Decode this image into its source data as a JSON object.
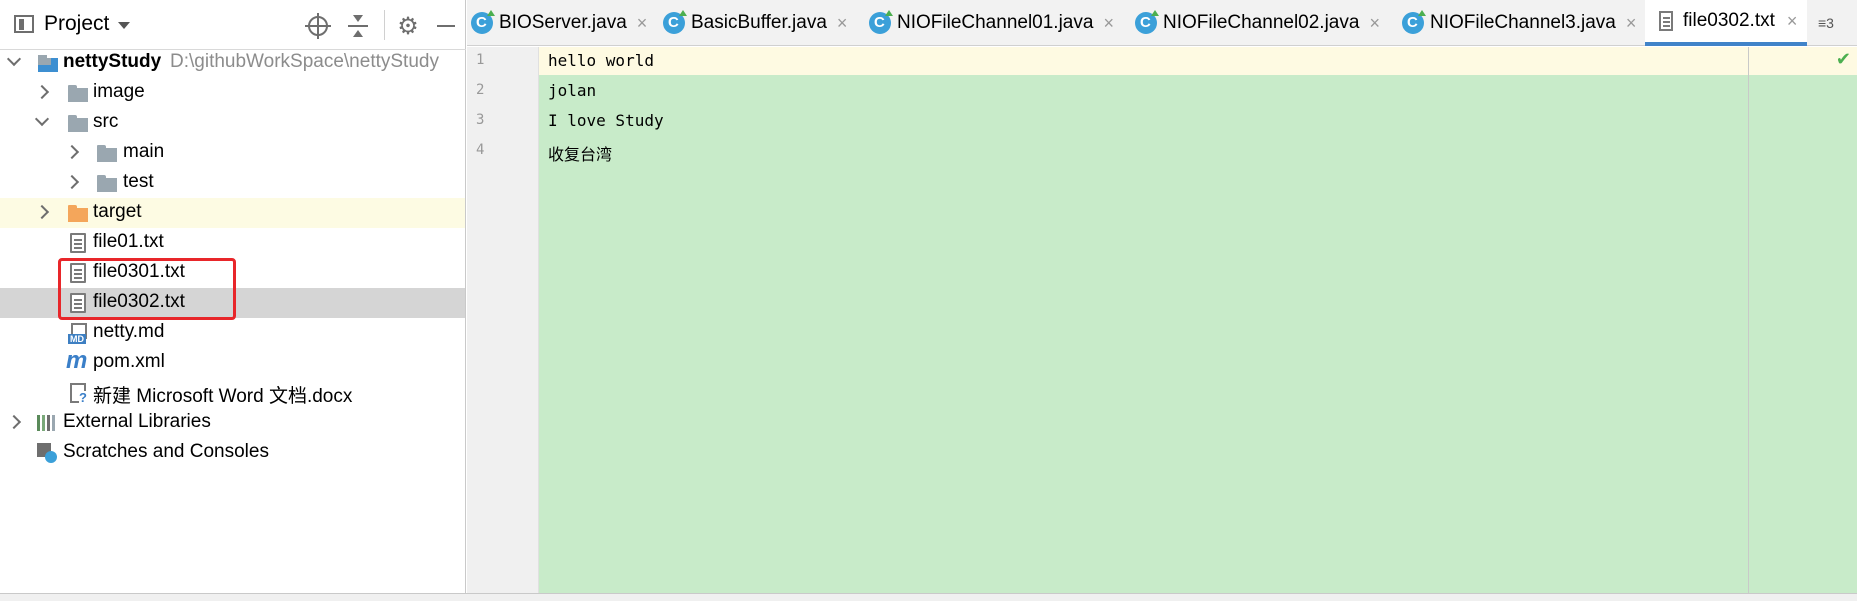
{
  "project_panel": {
    "title": "Project",
    "tree": {
      "root_name": "nettyStudy",
      "root_path": "D:\\githubWorkSpace\\nettyStudy",
      "items": [
        {
          "label": "image"
        },
        {
          "label": "src"
        },
        {
          "label": "main"
        },
        {
          "label": "test"
        },
        {
          "label": "target"
        },
        {
          "label": "file01.txt"
        },
        {
          "label": "file0301.txt"
        },
        {
          "label": "file0302.txt"
        },
        {
          "label": "netty.md"
        },
        {
          "label": "pom.xml"
        },
        {
          "label": "新建 Microsoft Word 文档.docx"
        },
        {
          "label": "External Libraries"
        },
        {
          "label": "Scratches and Consoles"
        }
      ]
    }
  },
  "tabs": [
    {
      "label": "BIOServer.java",
      "close": "×"
    },
    {
      "label": "BasicBuffer.java",
      "close": "×"
    },
    {
      "label": "NIOFileChannel01.java",
      "close": "×"
    },
    {
      "label": "NIOFileChannel02.java",
      "close": "×"
    },
    {
      "label": "NIOFileChannel3.java",
      "close": "×"
    },
    {
      "label": "file0302.txt",
      "close": "×"
    }
  ],
  "tab_overflow": "≡3",
  "editor": {
    "line_numbers": [
      "1",
      "2",
      "3",
      "4"
    ],
    "lines": [
      "hello world",
      "jolan",
      "I love Study",
      "收复台湾"
    ],
    "inspection_status": "✔"
  },
  "colors": {
    "editor_background": "#c8ebc9",
    "current_line": "#fefae2",
    "selection_highlight": "#e8262a",
    "active_tab_underline": "#4083c9"
  }
}
